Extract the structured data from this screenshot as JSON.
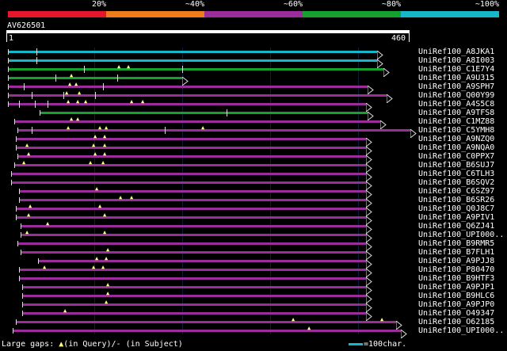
{
  "scale_legend": [
    {
      "label": "20%",
      "color": "#e8162b"
    },
    {
      "label": "~40%",
      "color": "#ee7c1d"
    },
    {
      "label": "~60%",
      "color": "#9b2d9a"
    },
    {
      "label": "~80%",
      "color": "#16a02d"
    },
    {
      "label": "~100%",
      "color": "#15b7c9"
    }
  ],
  "query": {
    "name": "AV626501",
    "start": "1",
    "end": "460"
  },
  "hits": [
    {
      "name": "UniRef100_A8JKA1",
      "color": "#15b7c9"
    },
    {
      "name": "UniRef100_A8I003",
      "color": "#15b7c9"
    },
    {
      "name": "UniRef100_C1E7Y4",
      "color": "#16a02d"
    },
    {
      "name": "UniRef100_A9U315",
      "color": "#16a02d"
    },
    {
      "name": "UniRef100_A9SPH7",
      "color": "#9b2d9a"
    },
    {
      "name": "UniRef100_Q00Y99",
      "color": "#9b2d9a"
    },
    {
      "name": "UniRef100_A4S5C8",
      "color": "#9b2d9a"
    },
    {
      "name": "UniRef100_A9TFS8",
      "color": "#16a02d"
    },
    {
      "name": "UniRef100_C1MZ88",
      "color": "#9b2d9a"
    },
    {
      "name": "UniRef100_C5YMH8",
      "color": "#9b2d9a"
    },
    {
      "name": "UniRef100_A9NZQ0",
      "color": "#9b2d9a"
    },
    {
      "name": "UniRef100_A9NQA0",
      "color": "#9b2d9a"
    },
    {
      "name": "UniRef100_C0PPX7",
      "color": "#9b2d9a"
    },
    {
      "name": "UniRef100_B6SUJ7",
      "color": "#9b2d9a"
    },
    {
      "name": "UniRef100_C6TLH3",
      "color": "#9b2d9a"
    },
    {
      "name": "UniRef100_B6SQV2",
      "color": "#9b2d9a"
    },
    {
      "name": "UniRef100_C6SZ97",
      "color": "#9b2d9a"
    },
    {
      "name": "UniRef100_B6SR26",
      "color": "#9b2d9a"
    },
    {
      "name": "UniRef100_Q0J8C7",
      "color": "#9b2d9a"
    },
    {
      "name": "UniRef100_A9PIV1",
      "color": "#9b2d9a"
    },
    {
      "name": "UniRef100_Q6ZJ41",
      "color": "#9b2d9a"
    },
    {
      "name": "UniRef100_UPI000..",
      "color": "#9b2d9a"
    },
    {
      "name": "UniRef100_B9RMR5",
      "color": "#9b2d9a"
    },
    {
      "name": "UniRef100_B7FLH1",
      "color": "#9b2d9a"
    },
    {
      "name": "UniRef100_A9PJJ8",
      "color": "#9b2d9a"
    },
    {
      "name": "UniRef100_P80470",
      "color": "#9b2d9a"
    },
    {
      "name": "UniRef100_B9HTF3",
      "color": "#9b2d9a"
    },
    {
      "name": "UniRef100_A9PJP1",
      "color": "#9b2d9a"
    },
    {
      "name": "UniRef100_B9HLC6",
      "color": "#9b2d9a"
    },
    {
      "name": "UniRef100_A9PJP0",
      "color": "#9b2d9a"
    },
    {
      "name": "UniRef100_O49347",
      "color": "#9b2d9a"
    },
    {
      "name": "UniRef100_O62185",
      "color": "#9b2d9a"
    },
    {
      "name": "UniRef100_UPI000..",
      "color": "#9b2d9a"
    }
  ],
  "footer": {
    "gaps_prefix": "Large gaps: ",
    "gaps_query": "(in Query)/",
    "gaps_dash": "-",
    "gaps_subject": " (in Subject)",
    "scale_text": "=100char."
  }
}
